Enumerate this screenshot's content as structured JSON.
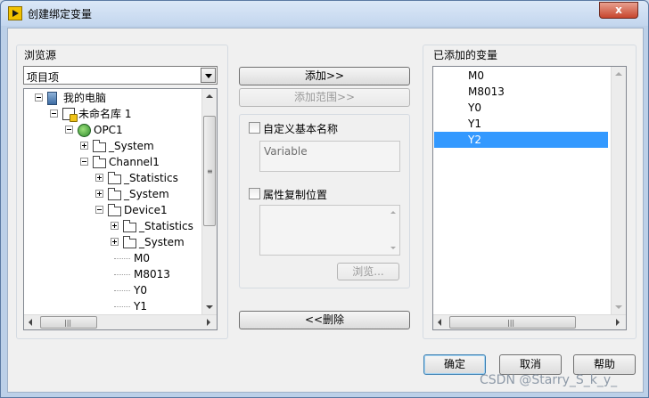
{
  "window": {
    "title": "创建绑定变量",
    "close_label": "x"
  },
  "browse_source": {
    "label": "浏览源",
    "combo_value": "项目项",
    "tree": [
      {
        "label": "我的电脑",
        "kind": "pc",
        "level": 0,
        "expanded": true
      },
      {
        "label": "未命名库 1",
        "kind": "lib",
        "level": 1,
        "expanded": true
      },
      {
        "label": "OPC1",
        "kind": "opc",
        "level": 2,
        "expanded": true
      },
      {
        "label": "_System",
        "kind": "folder",
        "level": 3,
        "expanded": false
      },
      {
        "label": "Channel1",
        "kind": "folder",
        "level": 3,
        "expanded": true
      },
      {
        "label": "_Statistics",
        "kind": "folder",
        "level": 4,
        "expanded": false
      },
      {
        "label": "_System",
        "kind": "folder",
        "level": 4,
        "expanded": false
      },
      {
        "label": "Device1",
        "kind": "folder",
        "level": 4,
        "expanded": true
      },
      {
        "label": "_Statistics",
        "kind": "folder",
        "level": 5,
        "expanded": false
      },
      {
        "label": "_System",
        "kind": "folder",
        "level": 5,
        "expanded": false
      },
      {
        "label": "M0",
        "kind": "leaf",
        "level": 5
      },
      {
        "label": "M8013",
        "kind": "leaf",
        "level": 5
      },
      {
        "label": "Y0",
        "kind": "leaf",
        "level": 5
      },
      {
        "label": "Y1",
        "kind": "leaf",
        "level": 5
      }
    ]
  },
  "middle": {
    "add_label": "添加>>",
    "add_range_label": "添加范围>>",
    "custom_base_name_label": "自定义基本名称",
    "base_name_value": "Variable",
    "attribute_copy_label": "属性复制位置",
    "browse_label": "浏览...",
    "remove_label": "<<删除"
  },
  "added_vars": {
    "label": "已添加的变量",
    "items": [
      "M0",
      "M8013",
      "Y0",
      "Y1",
      "Y2"
    ],
    "selected_index": 4
  },
  "footer": {
    "ok_label": "确定",
    "cancel_label": "取消",
    "help_label": "帮助"
  },
  "watermark": "CSDN @Starry_S_k_y_",
  "colors": {
    "selection": "#3399ff",
    "close_button": "#c7462d"
  }
}
